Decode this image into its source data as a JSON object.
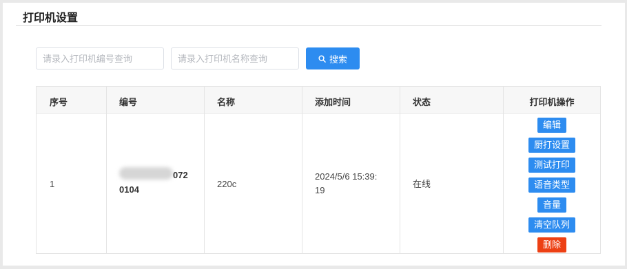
{
  "page": {
    "title": "打印机设置"
  },
  "search": {
    "number_placeholder": "请录入打印机编号查询",
    "name_placeholder": "请录入打印机名称查询",
    "button_label": "搜索"
  },
  "table": {
    "headers": [
      "序号",
      "编号",
      "名称",
      "添加时间",
      "状态",
      "打印机操作"
    ],
    "rows": [
      {
        "index": "1",
        "number_line1": "072",
        "number_line2": "0104",
        "name": "220c",
        "time_line1": "2024/5/6 15:39:",
        "time_line2": "19",
        "status": "在线",
        "actions": [
          "编辑",
          "厨打设置",
          "测试打印",
          "语音类型",
          "音量",
          "清空队列",
          "删除"
        ]
      }
    ]
  },
  "colors": {
    "primary": "#2d8cf0",
    "danger": "#ed4014"
  },
  "icons": {
    "search": "search-icon"
  }
}
